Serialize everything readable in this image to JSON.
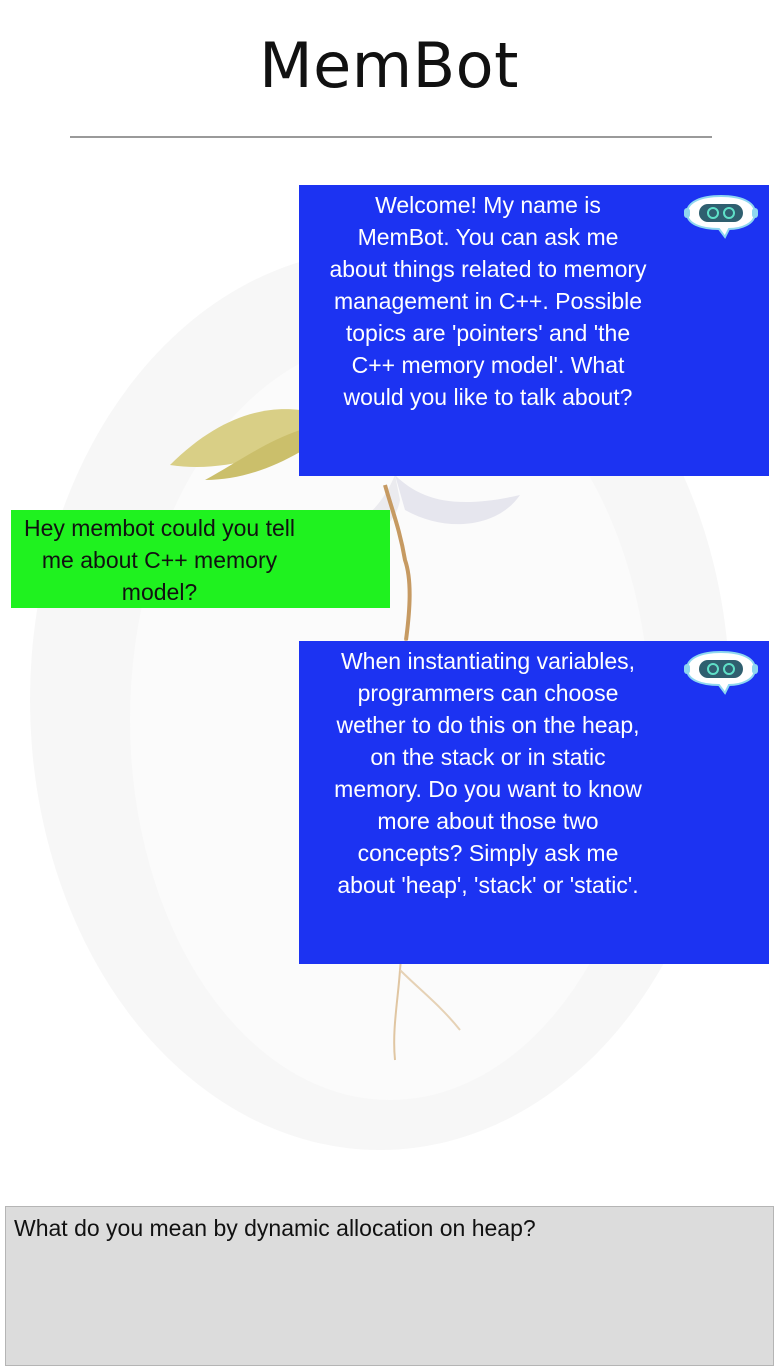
{
  "header": {
    "title": "MemBot"
  },
  "conversation": {
    "messages": [
      {
        "sender": "bot",
        "text": "Welcome! My name is MemBot. You can ask me about things related to memory management in C++. Possible topics are 'pointers' and 'the C++ memory model'. What would you like to talk about?"
      },
      {
        "sender": "user",
        "text": "Hey membot could you tell me about C++ memory model?"
      },
      {
        "sender": "bot",
        "text": "When instantiating variables, programmers can choose wether to do this on the heap, on the stack or in static memory. Do you want to know more about those two concepts? Simply ask me about 'heap', 'stack' or 'static'."
      }
    ]
  },
  "composer": {
    "value": "What do you mean by dynamic allocation on heap?"
  },
  "icons": {
    "bot_avatar": "robot-chat-icon"
  },
  "colors": {
    "bot_bubble": "#1c33f2",
    "user_bubble": "#1ff21f",
    "input_bg": "#dcdcdc"
  }
}
